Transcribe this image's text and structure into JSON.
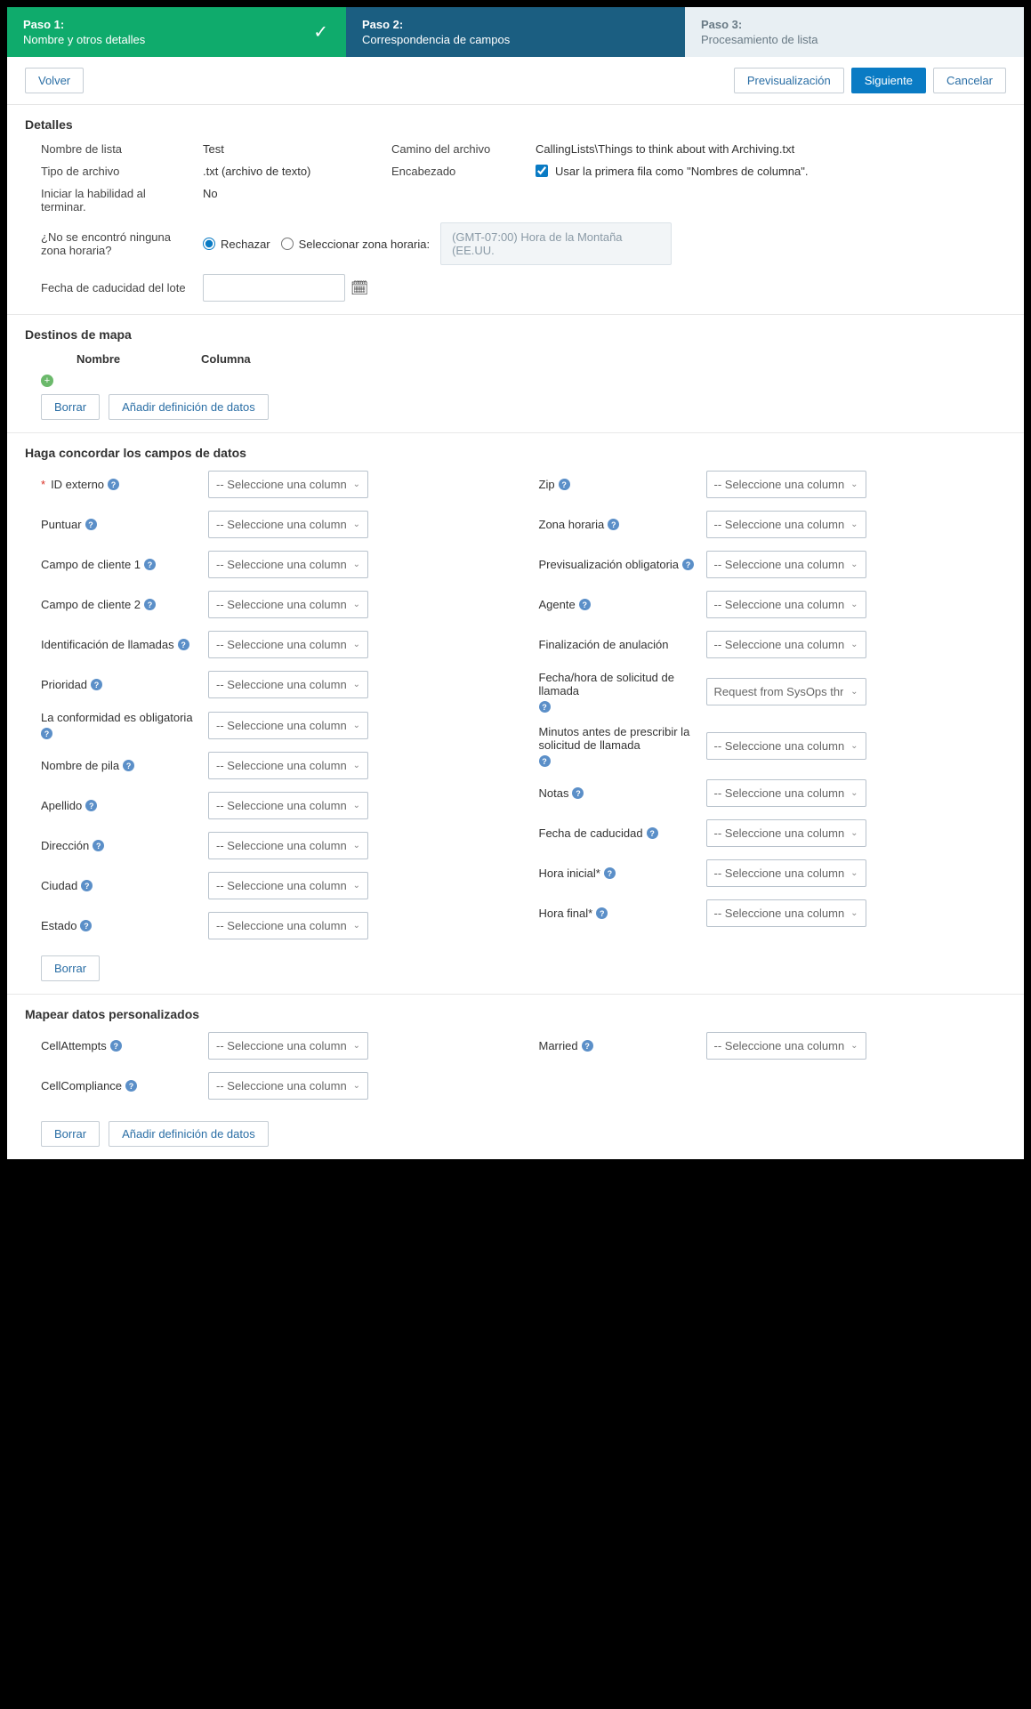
{
  "steps": {
    "s1": {
      "title": "Paso 1:",
      "sub": "Nombre y otros detalles"
    },
    "s2": {
      "title": "Paso 2:",
      "sub": "Correspondencia de campos"
    },
    "s3": {
      "title": "Paso 3:",
      "sub": "Procesamiento de lista"
    }
  },
  "topbar": {
    "back": "Volver",
    "preview": "Previsualización",
    "next": "Siguiente",
    "cancel": "Cancelar"
  },
  "details": {
    "title": "Detalles",
    "listname_label": "Nombre de lista",
    "listname_val": "Test",
    "filepath_label": "Camino del archivo",
    "filepath_val": "CallingLists\\Things to think about with Archiving.txt",
    "filetype_label": "Tipo de archivo",
    "filetype_val": ".txt (archivo de texto)",
    "header_label": "Encabezado",
    "header_chk": "Usar la primera fila como \"Nombres de columna\".",
    "startskill_label": "Iniciar la habilidad al terminar.",
    "startskill_val": "No",
    "notz_label": "¿No se encontró ninguna zona horaria?",
    "reject": "Rechazar",
    "selecttz": "Seleccionar zona horaria:",
    "tz_val": "(GMT-07:00) Hora de la Montaña (EE.UU.",
    "expiry_label": "Fecha de caducidad del lote"
  },
  "mapdest": {
    "title": "Destinos de mapa",
    "name_h": "Nombre",
    "col_h": "Columna",
    "clear": "Borrar",
    "add": "Añadir definición de datos"
  },
  "match": {
    "title": "Haga concordar los campos de datos",
    "placeholder": "-- Seleccione una column",
    "special": "Request from SysOps thr",
    "left": [
      {
        "label": "ID externo",
        "req": true
      },
      {
        "label": "Puntuar"
      },
      {
        "label": "Campo de cliente 1"
      },
      {
        "label": "Campo de cliente 2"
      },
      {
        "label": "Identificación de llamadas"
      },
      {
        "label": "Prioridad"
      },
      {
        "label": "La conformidad es obligatoria"
      },
      {
        "label": "Nombre de pila"
      },
      {
        "label": "Apellido"
      },
      {
        "label": "Dirección"
      },
      {
        "label": "Ciudad"
      },
      {
        "label": "Estado"
      }
    ],
    "right": [
      {
        "label": "Zip"
      },
      {
        "label": "Zona horaria"
      },
      {
        "label": "Previsualización obligatoria"
      },
      {
        "label": "Agente"
      },
      {
        "label": "Finalización de anulación",
        "nohelp": true
      },
      {
        "label": "Fecha/hora de solicitud de llamada",
        "special": true
      },
      {
        "label": "Minutos antes de prescribir la solicitud de llamada"
      },
      {
        "label": "Notas"
      },
      {
        "label": "Fecha de caducidad"
      },
      {
        "label": "Hora inicial*"
      },
      {
        "label": "Hora final*"
      }
    ],
    "clear": "Borrar"
  },
  "custom": {
    "title": "Mapear datos personalizados",
    "left": [
      {
        "label": "CellAttempts"
      },
      {
        "label": "CellCompliance"
      }
    ],
    "right": [
      {
        "label": "Married"
      }
    ],
    "clear": "Borrar",
    "add": "Añadir definición de datos"
  }
}
